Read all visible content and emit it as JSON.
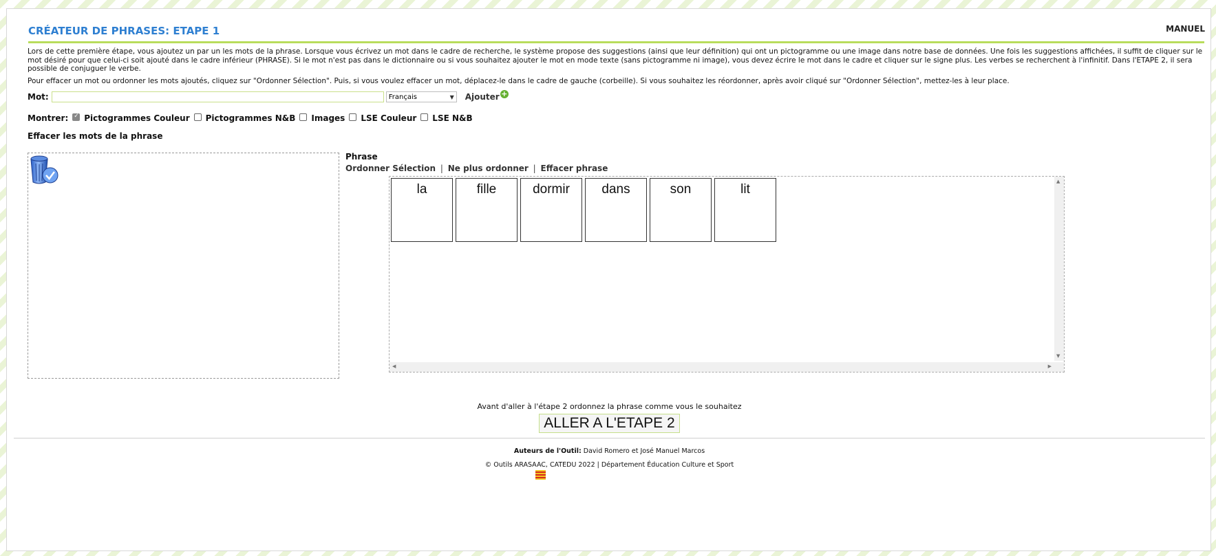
{
  "header": {
    "title": "CRÉATEUR DE PHRASES: ETAPE 1",
    "manual_link": "MANUEL"
  },
  "description": {
    "paragraph1": "Lors de cette première étape, vous ajoutez un par un les mots de la phrase. Lorsque vous écrivez un mot dans le cadre de recherche, le système propose des suggestions (ainsi que leur définition) qui ont un pictogramme ou une image dans notre base de données. Une fois les suggestions affichées, il suffit de cliquer sur le mot désiré pour que celui-ci soit ajouté dans le cadre inférieur (PHRASE). Si le mot n'est pas dans le dictionnaire ou si vous souhaitez ajouter le mot en mode texte (sans pictogramme ni image), vous devez écrire le mot dans le cadre et cliquer sur le signe plus. Les verbes se recherchent à l'infinitif. Dans l'ETAPE 2, il sera possible de conjuguer le verbe.",
    "paragraph2": "Pour effacer un mot ou ordonner les mots ajoutés, cliquez sur \"Ordonner Sélection\". Puis, si vous voulez effacer un mot, déplacez-le dans le cadre de gauche (corbeille). Si vous souhaitez les réordonner, après avoir cliqué sur \"Ordonner Sélection\", mettez-les à leur place."
  },
  "search": {
    "label": "Mot:",
    "value": "",
    "placeholder": "",
    "language_selected": "Français",
    "add_label": "Ajouter"
  },
  "show_options": {
    "label": "Montrer:",
    "options": [
      {
        "label": "Pictogrammes Couleur",
        "checked": true
      },
      {
        "label": "Pictogrammes N&B",
        "checked": false
      },
      {
        "label": "Images",
        "checked": false
      },
      {
        "label": "LSE Couleur",
        "checked": false
      },
      {
        "label": "LSE N&B",
        "checked": false
      }
    ]
  },
  "trash": {
    "label": "Effacer les mots de la phrase",
    "icon": "trash-icon"
  },
  "phrase": {
    "label": "Phrase",
    "links": {
      "order": "Ordonner Sélection",
      "stop_order": "Ne plus ordonner",
      "clear": "Effacer phrase",
      "separator": "|"
    },
    "words": [
      "la",
      "fille",
      "dormir",
      "dans",
      "son",
      "lit"
    ]
  },
  "next_step": {
    "hint": "Avant d'aller à l'étape 2 ordonnez la phrase comme vous le souhaitez",
    "button": "ALLER A L'ETAPE 2"
  },
  "footer": {
    "authors_label": "Auteurs de l'Outil:",
    "authors": "David Romero et José Manuel Marcos",
    "copyright": "© Outils ARASAAC, CATEDU 2022 | Département Éducation Culture et Sport"
  },
  "colors": {
    "title": "#2e7fd1",
    "accent_line": "#b8dd5c",
    "plus_icon": "#66b032"
  }
}
